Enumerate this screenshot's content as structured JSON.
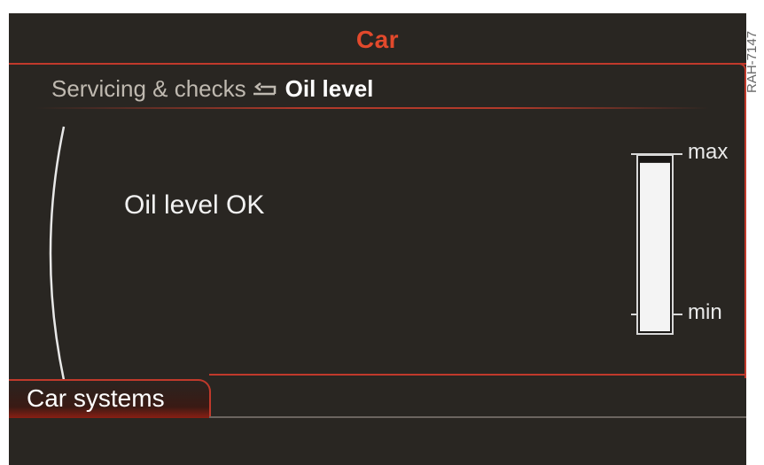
{
  "screen": {
    "title": "Car",
    "breadcrumb": {
      "parent": "Servicing & checks",
      "current": "Oil level",
      "separator_icon": "return-arrow-icon"
    },
    "status_text": "Oil level OK",
    "gauge": {
      "max_label": "max",
      "min_label": "min",
      "fill_fraction": 0.97
    },
    "footer_tab": "Car systems"
  },
  "watermark": "RAH-7147",
  "colors": {
    "accent": "#e2492c",
    "background": "#292622"
  }
}
